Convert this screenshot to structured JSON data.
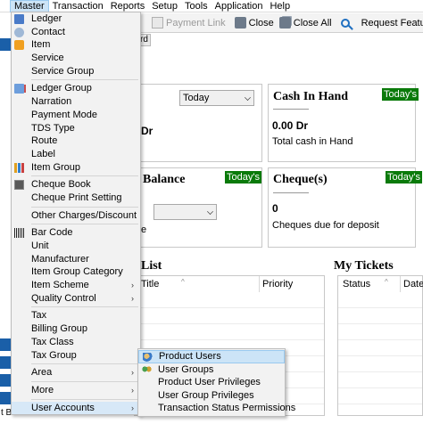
{
  "menubar": {
    "items": [
      "Master",
      "Transaction",
      "Reports",
      "Setup",
      "Tools",
      "Application",
      "Help"
    ],
    "active": "Master"
  },
  "toolbar": {
    "payment_link": "Payment Link",
    "close": "Close",
    "close_all": "Close All",
    "request_feature": "Request Feature"
  },
  "master_menu": {
    "items": [
      {
        "label": "Ledger",
        "icon": "ledger-icon",
        "submenu": false
      },
      {
        "label": "Contact",
        "icon": "contact-icon",
        "submenu": false
      },
      {
        "label": "Item",
        "icon": "item-icon",
        "submenu": false
      },
      {
        "label": "Service",
        "icon": "",
        "submenu": false
      },
      {
        "label": "Service Group",
        "icon": "",
        "submenu": false
      },
      {
        "sep": true
      },
      {
        "label": "Ledger Group",
        "icon": "group-icon",
        "submenu": false
      },
      {
        "label": "Narration",
        "icon": "",
        "submenu": false
      },
      {
        "label": "Payment Mode",
        "icon": "",
        "submenu": false
      },
      {
        "label": "TDS Type",
        "icon": "",
        "submenu": false
      },
      {
        "label": "Route",
        "icon": "",
        "submenu": false
      },
      {
        "label": "Label",
        "icon": "",
        "submenu": false
      },
      {
        "label": "Item Group",
        "icon": "chart-icon",
        "submenu": false
      },
      {
        "sep": true
      },
      {
        "label": "Cheque Book",
        "icon": "cheque-icon",
        "submenu": false
      },
      {
        "label": "Cheque Print Setting",
        "icon": "",
        "submenu": false
      },
      {
        "sep": true
      },
      {
        "label": "Other Charges/Discount",
        "icon": "",
        "submenu": false
      },
      {
        "sep": true
      },
      {
        "label": "Bar Code",
        "icon": "barcode-icon",
        "submenu": false
      },
      {
        "label": "Unit",
        "icon": "",
        "submenu": false
      },
      {
        "label": "Manufacturer",
        "icon": "",
        "submenu": false
      },
      {
        "label": "Item Group Category",
        "icon": "",
        "submenu": false
      },
      {
        "label": "Item Scheme",
        "icon": "",
        "submenu": true
      },
      {
        "label": "Quality Control",
        "icon": "",
        "submenu": true
      },
      {
        "sep": true
      },
      {
        "label": "Tax",
        "icon": "",
        "submenu": false
      },
      {
        "label": "Billing Group",
        "icon": "",
        "submenu": false
      },
      {
        "label": "Tax Class",
        "icon": "",
        "submenu": false
      },
      {
        "label": "Tax Group",
        "icon": "",
        "submenu": false
      },
      {
        "sep": true
      },
      {
        "label": "Area",
        "icon": "",
        "submenu": true
      },
      {
        "sep": true
      },
      {
        "label": "More",
        "icon": "",
        "submenu": true
      },
      {
        "sep": true
      },
      {
        "label": "User Accounts",
        "icon": "",
        "submenu": true,
        "highlight": true
      }
    ]
  },
  "user_accounts_menu": {
    "items": [
      {
        "label": "Product Users",
        "icon": "users-icon",
        "highlight": true
      },
      {
        "label": "User Groups",
        "icon": "user-groups-icon"
      },
      {
        "label": "Product User Privileges",
        "icon": ""
      },
      {
        "label": "User Group Privileges",
        "icon": ""
      },
      {
        "label": "Transaction Status Permissions",
        "icon": ""
      }
    ]
  },
  "dashboard": {
    "tab_fragment": "rd",
    "date_filter": "Today",
    "dr_fragment": "Dr",
    "cash_in_hand": {
      "title": "Cash In Hand",
      "badge": "Today's",
      "value": "0.00 Dr",
      "desc": "Total cash in Hand"
    },
    "balance": {
      "title_fragment": "Balance",
      "badge": "Today's",
      "desc_fragment": "e"
    },
    "cheques": {
      "title": "Cheque(s)",
      "badge": "Today's",
      "value": "0",
      "desc": "Cheques due for deposit"
    },
    "list": {
      "title_fragment": "List",
      "columns": [
        "Title",
        "Priority"
      ]
    },
    "my_tickets": {
      "title": "My Tickets",
      "columns": [
        "Status",
        "Date"
      ]
    },
    "bottom_fragment": "t B"
  },
  "colors": {
    "badge_bg": "#0a7a0a",
    "menu_highlight": "#cce4f7",
    "left_strip": "#1a5fa8"
  }
}
